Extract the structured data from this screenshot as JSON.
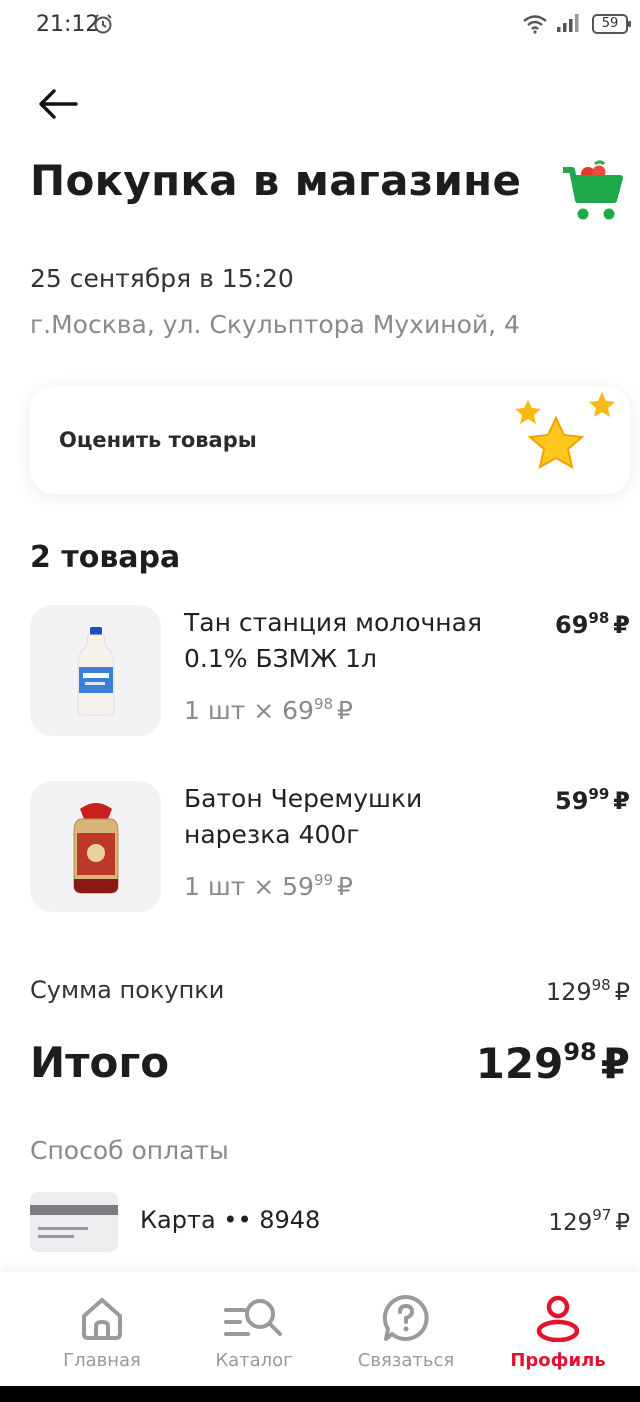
{
  "status_bar": {
    "time": "21:12",
    "battery": "59"
  },
  "header": {
    "title": "Покупка в магазине"
  },
  "purchase": {
    "date": "25 сентября в 15:20",
    "address": "г.Москва, ул. Скульптора Мухиной, 4"
  },
  "rate": {
    "label": "Оценить товары"
  },
  "items": {
    "count": "2 товара",
    "list": [
      {
        "name": "Тан станция молочная 0.1% БЗМЖ 1л",
        "qty_prefix": "1 шт ×",
        "unit_rub": "69",
        "unit_kop": "98",
        "price_rub": "69",
        "price_kop": "98"
      },
      {
        "name": "Батон Черемушки нарезка 400г",
        "qty_prefix": "1 шт ×",
        "unit_rub": "59",
        "unit_kop": "99",
        "price_rub": "59",
        "price_kop": "99"
      }
    ]
  },
  "summary": {
    "sum_label": "Сумма покупки",
    "sum_rub": "129",
    "sum_kop": "98",
    "total_label": "Итого",
    "total_rub": "129",
    "total_kop": "98",
    "currency": "₽"
  },
  "payment": {
    "title": "Способ оплаты",
    "card_label": "Карта •• 8948",
    "amount_rub": "129",
    "amount_kop": "97"
  },
  "nav": [
    {
      "label": "Главная",
      "icon": "home-icon",
      "active": false
    },
    {
      "label": "Каталог",
      "icon": "catalog-search-icon",
      "active": false
    },
    {
      "label": "Связаться",
      "icon": "help-chat-icon",
      "active": false
    },
    {
      "label": "Профиль",
      "icon": "profile-icon",
      "active": true
    }
  ],
  "colors": {
    "accent": "#e1142f",
    "cart_green": "#1ea84a",
    "star": "#f7b916"
  }
}
